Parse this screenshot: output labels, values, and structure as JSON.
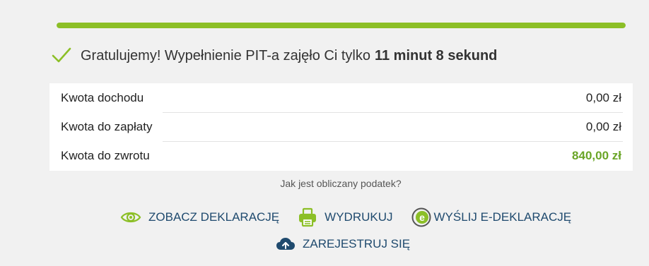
{
  "progress": {
    "percent": 100,
    "color": "#8cbf27"
  },
  "congrats": {
    "message": "Gratulujemy! Wypełnienie PIT-a zajęło Ci tylko",
    "duration": "11 minut 8 sekund"
  },
  "summary": {
    "rows": [
      {
        "label": "Kwota dochodu",
        "value": "0,00 zł"
      },
      {
        "label": "Kwota do zapłaty",
        "value": "0,00 zł"
      },
      {
        "label": "Kwota do zwrotu",
        "value": "840,00 zł"
      }
    ],
    "highlight_color": "#6aa527"
  },
  "tax_link": "Jak jest obliczany podatek?",
  "actions": {
    "view_declaration": {
      "label": "ZOBACZ DEKLARACJĘ",
      "icon": "eye-icon"
    },
    "print": {
      "label": "WYDRUKUJ",
      "icon": "printer-icon"
    },
    "send_edeclaration": {
      "label": "WYŚLIJ E-DEKLARACJĘ",
      "icon": "e-declaration-icon"
    },
    "register": {
      "label": "ZAREJESTRUJ SIĘ",
      "icon": "cloud-upload-icon"
    }
  },
  "colors": {
    "accent_green": "#8cbf27",
    "link_blue": "#1f4a6e",
    "background": "#f1f1f1"
  }
}
